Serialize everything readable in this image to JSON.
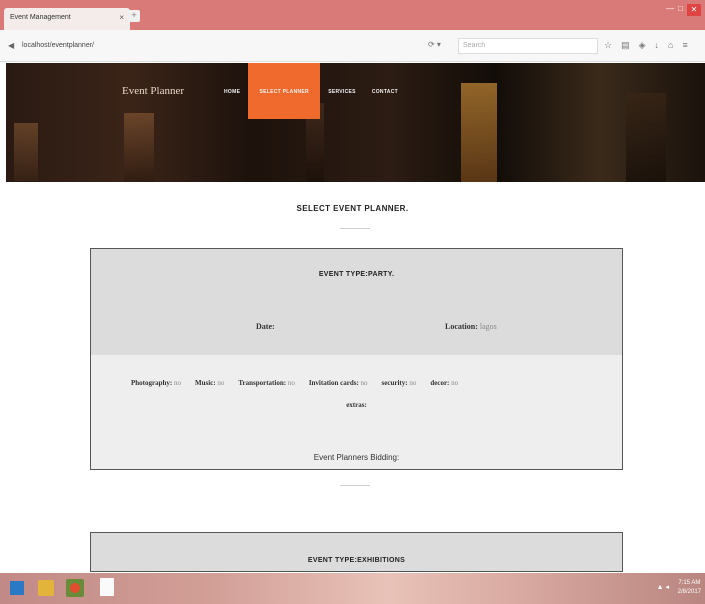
{
  "browser": {
    "tab_title": "Event Management",
    "tab_close": "×",
    "new_tab": "+",
    "url": "localhost/eventplanner/",
    "search_placeholder": "Search",
    "window_controls": [
      "—",
      "□"
    ],
    "close_glyph": "✕"
  },
  "site": {
    "brand": "Event Planner",
    "menu": [
      {
        "label": "HOME",
        "active": false
      },
      {
        "label": "SELECT PLANNER",
        "active": true
      },
      {
        "label": "SERVICES",
        "active": false
      },
      {
        "label": "CONTACT",
        "active": false
      }
    ]
  },
  "page": {
    "title": "SELECT EVENT PLANNER."
  },
  "cards": [
    {
      "event_type": "EVENT TYPE:PARTY.",
      "date_label": "Date:",
      "date_value": "",
      "location_label": "Location:",
      "location_value": "lagos",
      "services": [
        {
          "label": "Photography:",
          "value": "no"
        },
        {
          "label": "Music:",
          "value": "no"
        },
        {
          "label": "Transportation:",
          "value": "no"
        },
        {
          "label": "Invitation cards:",
          "value": "no"
        },
        {
          "label": "security:",
          "value": "no"
        },
        {
          "label": "decor:",
          "value": "no"
        }
      ],
      "extras_label": "extras:",
      "bidding_text": "Event Planners Bidding:"
    },
    {
      "event_type": "EVENT TYPE:EXHIBITIONS"
    }
  ],
  "taskbar": {
    "tray": "▲ ◂",
    "clock_time": "7:15 AM",
    "clock_date": "2/8/2017"
  },
  "colors": {
    "accent": "#ef6a2c",
    "titlebar": "#d97a78",
    "card_top": "#dcdcdc",
    "card_bottom": "#eeeeee"
  }
}
